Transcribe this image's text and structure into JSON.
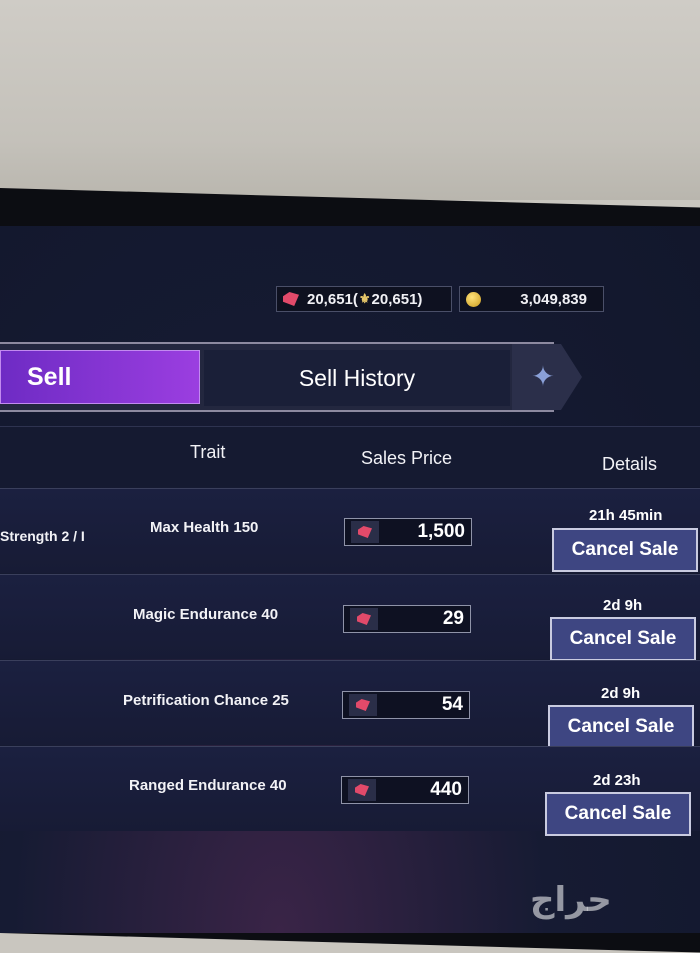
{
  "currency": {
    "diamonds": "20,651(",
    "diamonds_bound": "20,651)",
    "gold": "3,049,839"
  },
  "tabs": {
    "sell": "Sell",
    "history": "Sell History"
  },
  "columns": {
    "trait": "Trait",
    "sales_price": "Sales Price",
    "details": "Details"
  },
  "rows": [
    {
      "name": "Strength 2 / I",
      "trait": "Max Health 150",
      "price": "1,500",
      "time": "21h 45min",
      "action": "Cancel Sale"
    },
    {
      "name": "",
      "trait": "Magic Endurance 40",
      "price": "29",
      "time": "2d 9h",
      "action": "Cancel Sale"
    },
    {
      "name": "",
      "trait": "Petrification Chance 25",
      "price": "54",
      "time": "2d 9h",
      "action": "Cancel Sale"
    },
    {
      "name": "",
      "trait": "Ranged Endurance 40",
      "price": "440",
      "time": "2d 23h",
      "action": "Cancel Sale"
    }
  ],
  "watermark": "حراج",
  "icons": [
    "diamond-icon",
    "shield-icon",
    "gold-coin-icon",
    "star-emblem-icon"
  ]
}
